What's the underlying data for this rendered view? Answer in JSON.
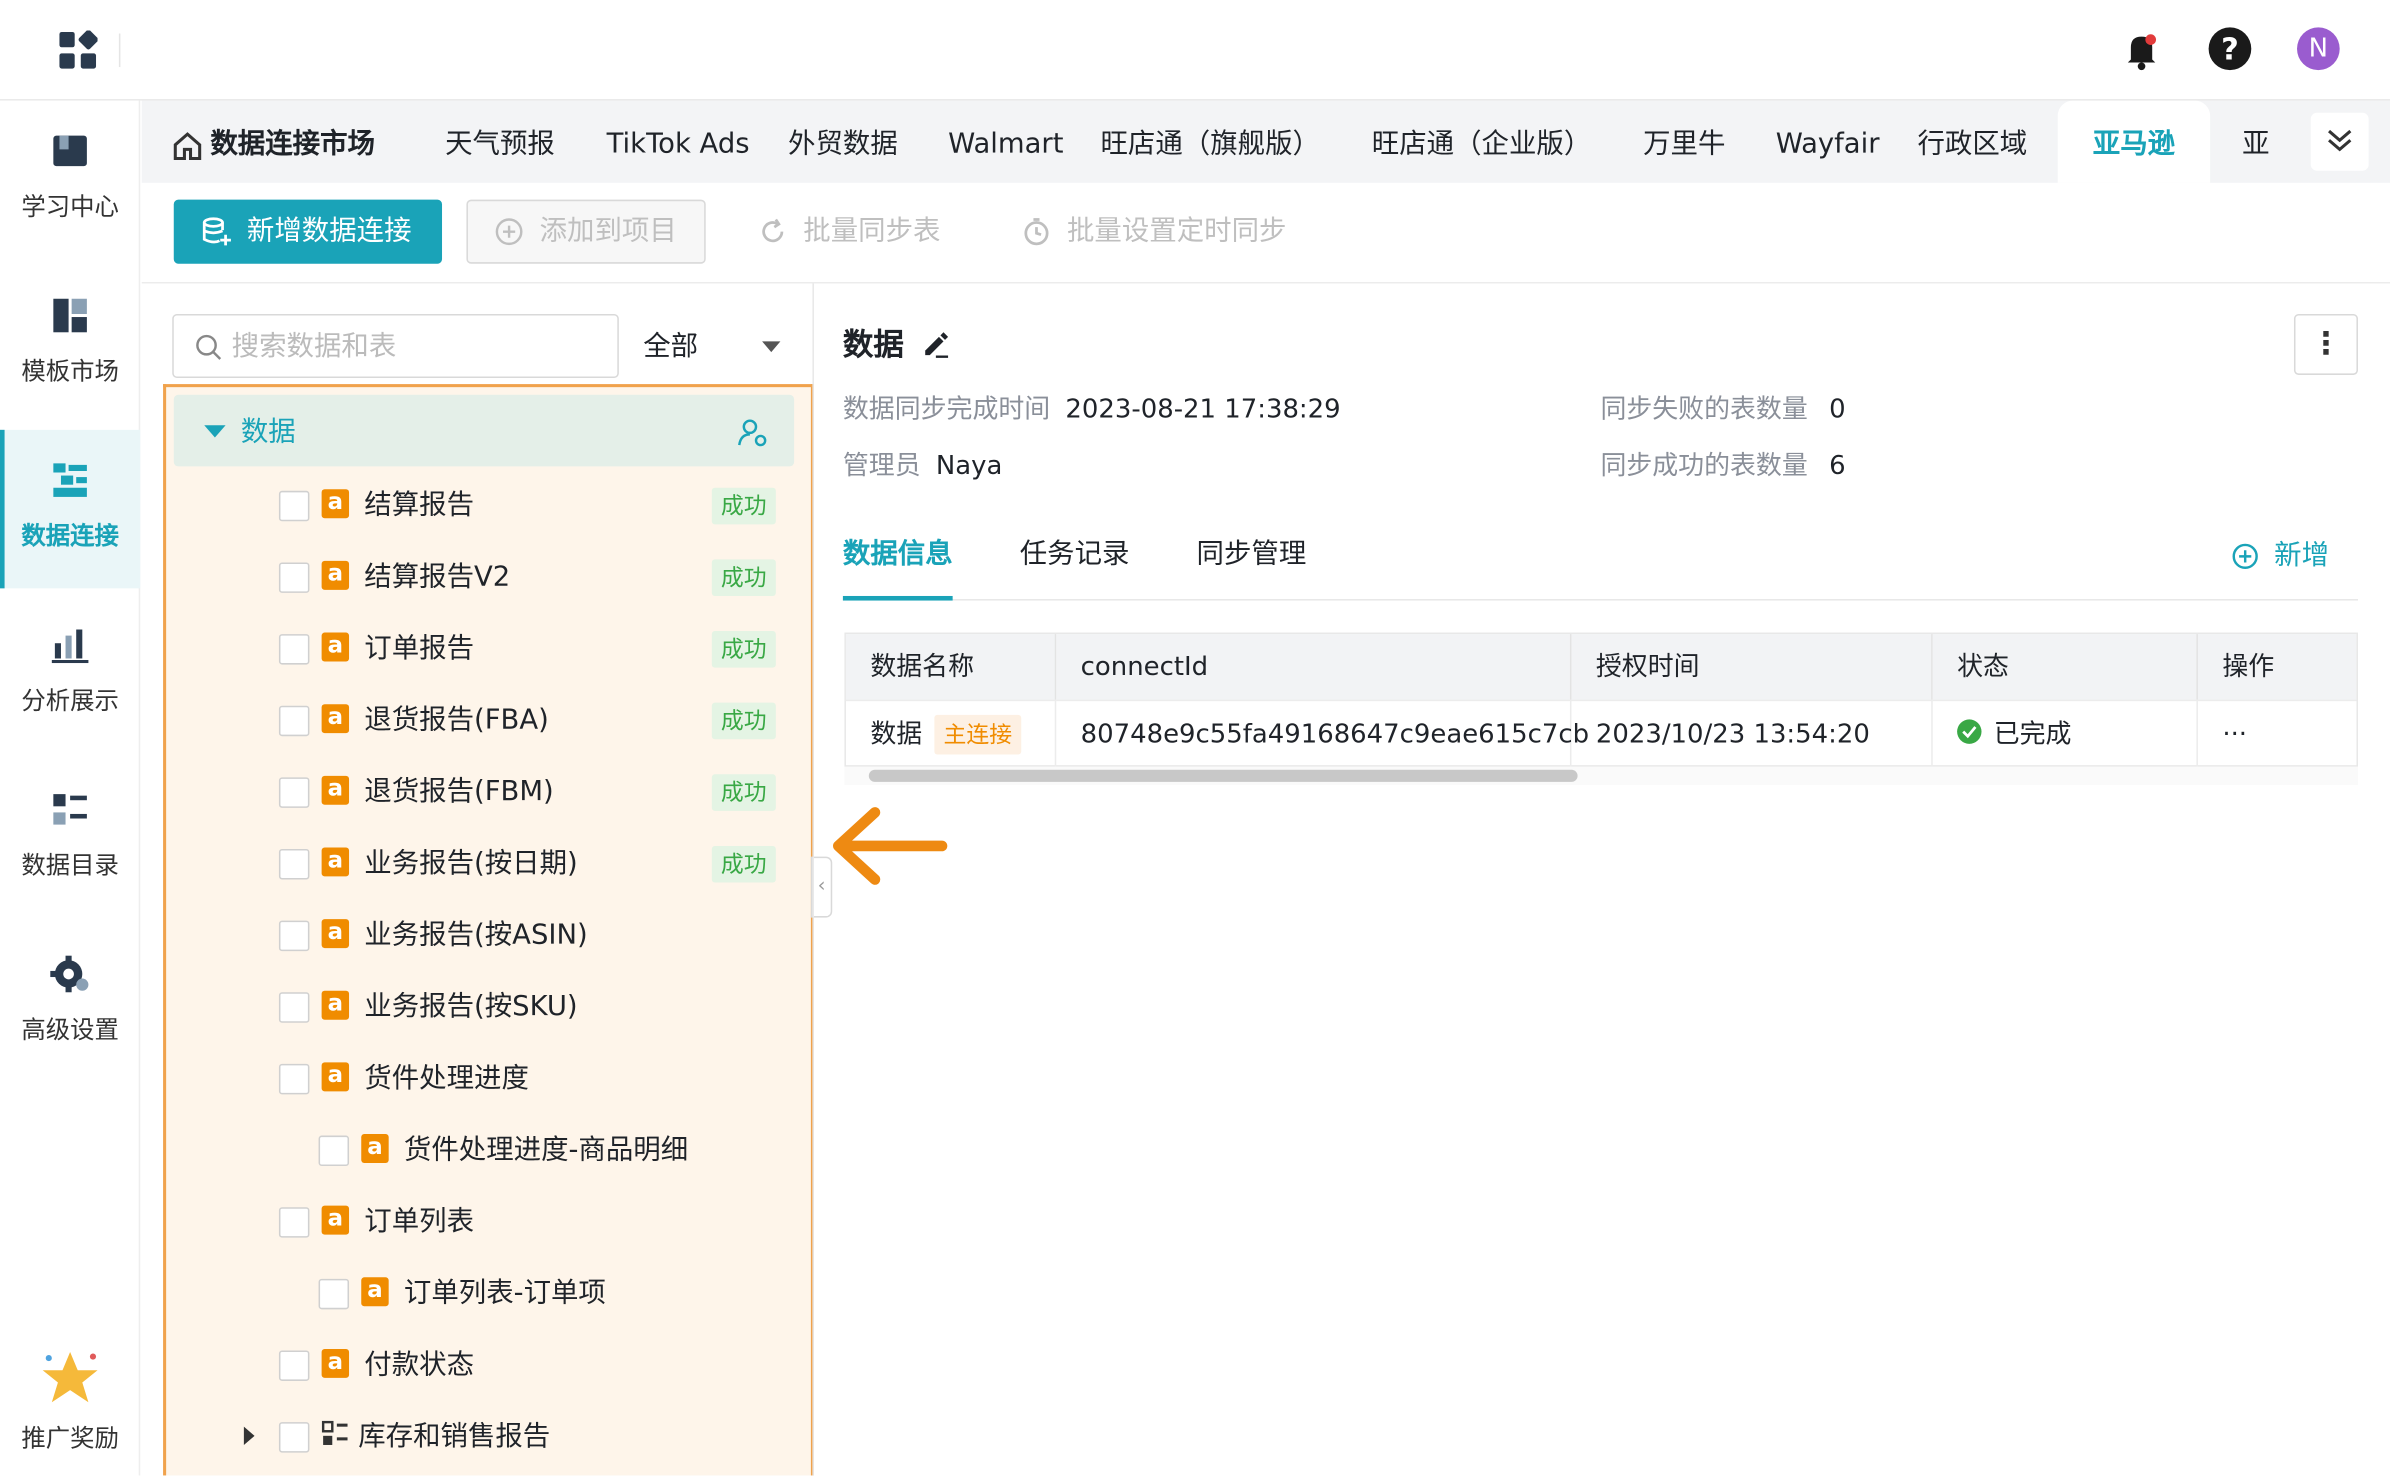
{
  "topbar": {
    "avatar_letter": "N",
    "help_symbol": "?"
  },
  "sidebar": {
    "items": [
      {
        "label": "学习中心",
        "icon": "book-icon"
      },
      {
        "label": "模板市场",
        "icon": "template-icon"
      },
      {
        "label": "数据连接",
        "icon": "data-connection-icon",
        "active": true
      },
      {
        "label": "分析展示",
        "icon": "chart-icon"
      },
      {
        "label": "数据目录",
        "icon": "catalog-icon"
      },
      {
        "label": "高级设置",
        "icon": "gear-icon"
      }
    ],
    "promo_label": "推广奖励"
  },
  "tabs": {
    "home": "数据连接市场",
    "items": [
      "天气预报",
      "TikTok Ads",
      "外贸数据",
      "Walmart",
      "旺店通（旗舰版）",
      "旺店通（企业版）",
      "万里牛",
      "Wayfair",
      "行政区域",
      "亚马逊",
      "亚"
    ],
    "active": "亚马逊"
  },
  "toolbar": {
    "new_connection": "新增数据连接",
    "add_to_project": "添加到项目",
    "batch_sync": "批量同步表",
    "batch_schedule": "批量设置定时同步"
  },
  "left_panel": {
    "search_placeholder": "搜索数据和表",
    "filter_value": "全部",
    "root_label": "数据",
    "rows": [
      {
        "label": "结算报告",
        "status": "成功",
        "level": 1
      },
      {
        "label": "结算报告V2",
        "status": "成功",
        "level": 1
      },
      {
        "label": "订单报告",
        "status": "成功",
        "level": 1
      },
      {
        "label": "退货报告(FBA)",
        "status": "成功",
        "level": 1
      },
      {
        "label": "退货报告(FBM)",
        "status": "成功",
        "level": 1
      },
      {
        "label": "业务报告(按日期)",
        "status": "成功",
        "level": 1
      },
      {
        "label": "业务报告(按ASIN)",
        "status": "",
        "level": 1
      },
      {
        "label": "业务报告(按SKU)",
        "status": "",
        "level": 1
      },
      {
        "label": "货件处理进度",
        "status": "",
        "level": 1
      },
      {
        "label": "货件处理进度-商品明细",
        "status": "",
        "level": 2
      },
      {
        "label": "订单列表",
        "status": "",
        "level": 1
      },
      {
        "label": "订单列表-订单项",
        "status": "",
        "level": 2
      },
      {
        "label": "付款状态",
        "status": "",
        "level": 1
      },
      {
        "label": "库存和销售报告",
        "status": "",
        "level": 1,
        "group": true
      }
    ]
  },
  "detail": {
    "title": "数据",
    "sync_time_label": "数据同步完成时间",
    "sync_time_value": "2023-08-21 17:38:29",
    "admin_label": "管理员",
    "admin_value": "Naya",
    "fail_count_label": "同步失败的表数量",
    "fail_count_value": "0",
    "success_count_label": "同步成功的表数量",
    "success_count_value": "6",
    "subtabs": [
      "数据信息",
      "任务记录",
      "同步管理"
    ],
    "add_label": "新增",
    "table": {
      "headers": [
        "数据名称",
        "connectId",
        "授权时间",
        "状态",
        "操作"
      ],
      "row": {
        "name": "数据",
        "tag": "主连接",
        "connect_id": "80748e9c55fa49168647c9eae615c7cb",
        "auth_time": "2023/10/23 13:54:20",
        "status": "已完成",
        "action": "···"
      }
    }
  },
  "colors": {
    "accent": "#1aa3b8",
    "amazon_orange": "#f08c00",
    "success_green": "#39a845",
    "highlight_border": "#f0a24c"
  }
}
